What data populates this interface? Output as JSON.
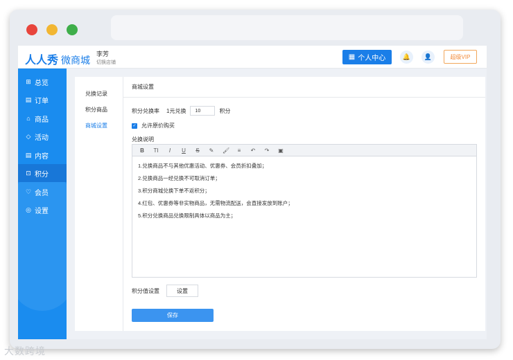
{
  "window": {
    "controls": [
      "close",
      "minimize",
      "maximize"
    ]
  },
  "header": {
    "logo_main": "人人秀",
    "logo_sub": "微商城",
    "user_name": "李芳",
    "switch_store": "切换店铺",
    "personal_center": "个人中心",
    "vip_label": "超级VIP",
    "icons": {
      "personal": "store-icon",
      "bell": "bell-icon",
      "user": "user-icon"
    }
  },
  "sidebar": {
    "items": [
      {
        "label": "总览",
        "icon": "grid-icon"
      },
      {
        "label": "订单",
        "icon": "order-icon"
      },
      {
        "label": "商品",
        "icon": "bag-icon"
      },
      {
        "label": "活动",
        "icon": "tag-icon"
      },
      {
        "label": "内容",
        "icon": "content-icon"
      },
      {
        "label": "积分",
        "icon": "points-icon"
      },
      {
        "label": "会员",
        "icon": "member-icon"
      },
      {
        "label": "设置",
        "icon": "settings-icon"
      }
    ],
    "active_index": 5
  },
  "subnav": {
    "items": [
      "兑换记录",
      "积分商品",
      "商城设置"
    ],
    "active_index": 2
  },
  "settings": {
    "title": "商城设置",
    "rate_label": "积分兑换率",
    "rate_prefix": "1元兑换",
    "rate_value": "10",
    "rate_unit": "积分",
    "allow_original_price": "允许原价购买",
    "allow_original_checked": true,
    "description_label": "兑换说明",
    "toolbar": [
      "B",
      "TI",
      "I",
      "U",
      "S",
      "✎",
      "🖌",
      "≡",
      "↶",
      "↷",
      "▣"
    ],
    "description_lines": [
      "1.兑换商品不与其他优惠活动、优惠券、会员折扣叠加；",
      "2.兑换商品一经兑换不可取消订单；",
      "3.积分商城兑换下单不返积分；",
      "4.红包、优惠券等非实物商品，无需物流配送，会直接发放到账户；",
      "5.积分兑换商品兑换限制具体以商品为主；"
    ],
    "points_value_label": "积分值设置",
    "points_value_button": "设置",
    "save_button": "保存"
  },
  "watermark": "大数跨境"
}
